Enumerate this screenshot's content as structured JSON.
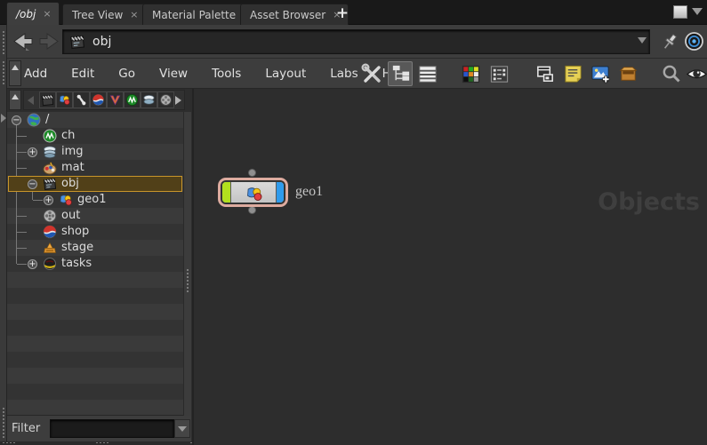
{
  "tab_bar": {
    "tabs": [
      {
        "label": "/obj",
        "active": true
      },
      {
        "label": "Tree View",
        "active": false
      },
      {
        "label": "Material Palette",
        "active": false
      },
      {
        "label": "Asset Browser",
        "active": false
      }
    ],
    "close_glyph": "×",
    "new_tab_label": "+",
    "pane_controls": [
      "maximize-pane",
      "pane-menu"
    ]
  },
  "nav_bar": {
    "path_value": "obj",
    "path_icon": "objects-network-icon",
    "buttons": [
      "back",
      "forward",
      "pin",
      "follow-network"
    ]
  },
  "menu_bar": {
    "items": [
      "Add",
      "Edit",
      "Go",
      "View",
      "Tools",
      "Layout",
      "Labs",
      "Help"
    ],
    "toolbar_icons": [
      "tools-wrench",
      "network-view (active)",
      "list-view",
      "color-palette",
      "thumbnail-grid",
      "window-layout",
      "sticky-note",
      "add-image",
      "asset-box",
      "search",
      "visibility-eye"
    ]
  },
  "tree_panel": {
    "toolbar_icons": [
      "objects-network",
      "geometry",
      "character",
      "shop-network",
      "vop-network",
      "chop-network",
      "img-network",
      "rop-network"
    ],
    "rows": [
      {
        "label": "/",
        "depth": 0,
        "icon": "root-globe-icon",
        "expander": "−",
        "selected": false
      },
      {
        "label": "ch",
        "depth": 1,
        "icon": "chopnet-icon",
        "expander": "",
        "selected": false
      },
      {
        "label": "img",
        "depth": 1,
        "icon": "imgnet-icon",
        "expander": "+",
        "selected": false
      },
      {
        "label": "mat",
        "depth": 1,
        "icon": "matnet-icon",
        "expander": "",
        "selected": false
      },
      {
        "label": "obj",
        "depth": 1,
        "icon": "objnet-icon",
        "expander": "−",
        "selected": true
      },
      {
        "label": "geo1",
        "depth": 2,
        "icon": "geometry-icon",
        "expander": "+",
        "selected": false
      },
      {
        "label": "out",
        "depth": 1,
        "icon": "ropnet-icon",
        "expander": "",
        "selected": false
      },
      {
        "label": "shop",
        "depth": 1,
        "icon": "shopnet-icon",
        "expander": "",
        "selected": false
      },
      {
        "label": "stage",
        "depth": 1,
        "icon": "stage-icon",
        "expander": "",
        "selected": false
      },
      {
        "label": "tasks",
        "depth": 1,
        "icon": "tasks-icon",
        "expander": "+",
        "selected": false
      }
    ],
    "selection_border_color": "#c8952a",
    "filter": {
      "label": "Filter",
      "value": "",
      "placeholder": ""
    }
  },
  "network_editor": {
    "watermark": "Objects",
    "nodes": [
      {
        "name": "geo1",
        "selected": true,
        "ring_color": "#ddab9f",
        "display_flag_color": "#b2e01e",
        "render_flag_color": "#2f9bec"
      }
    ]
  }
}
